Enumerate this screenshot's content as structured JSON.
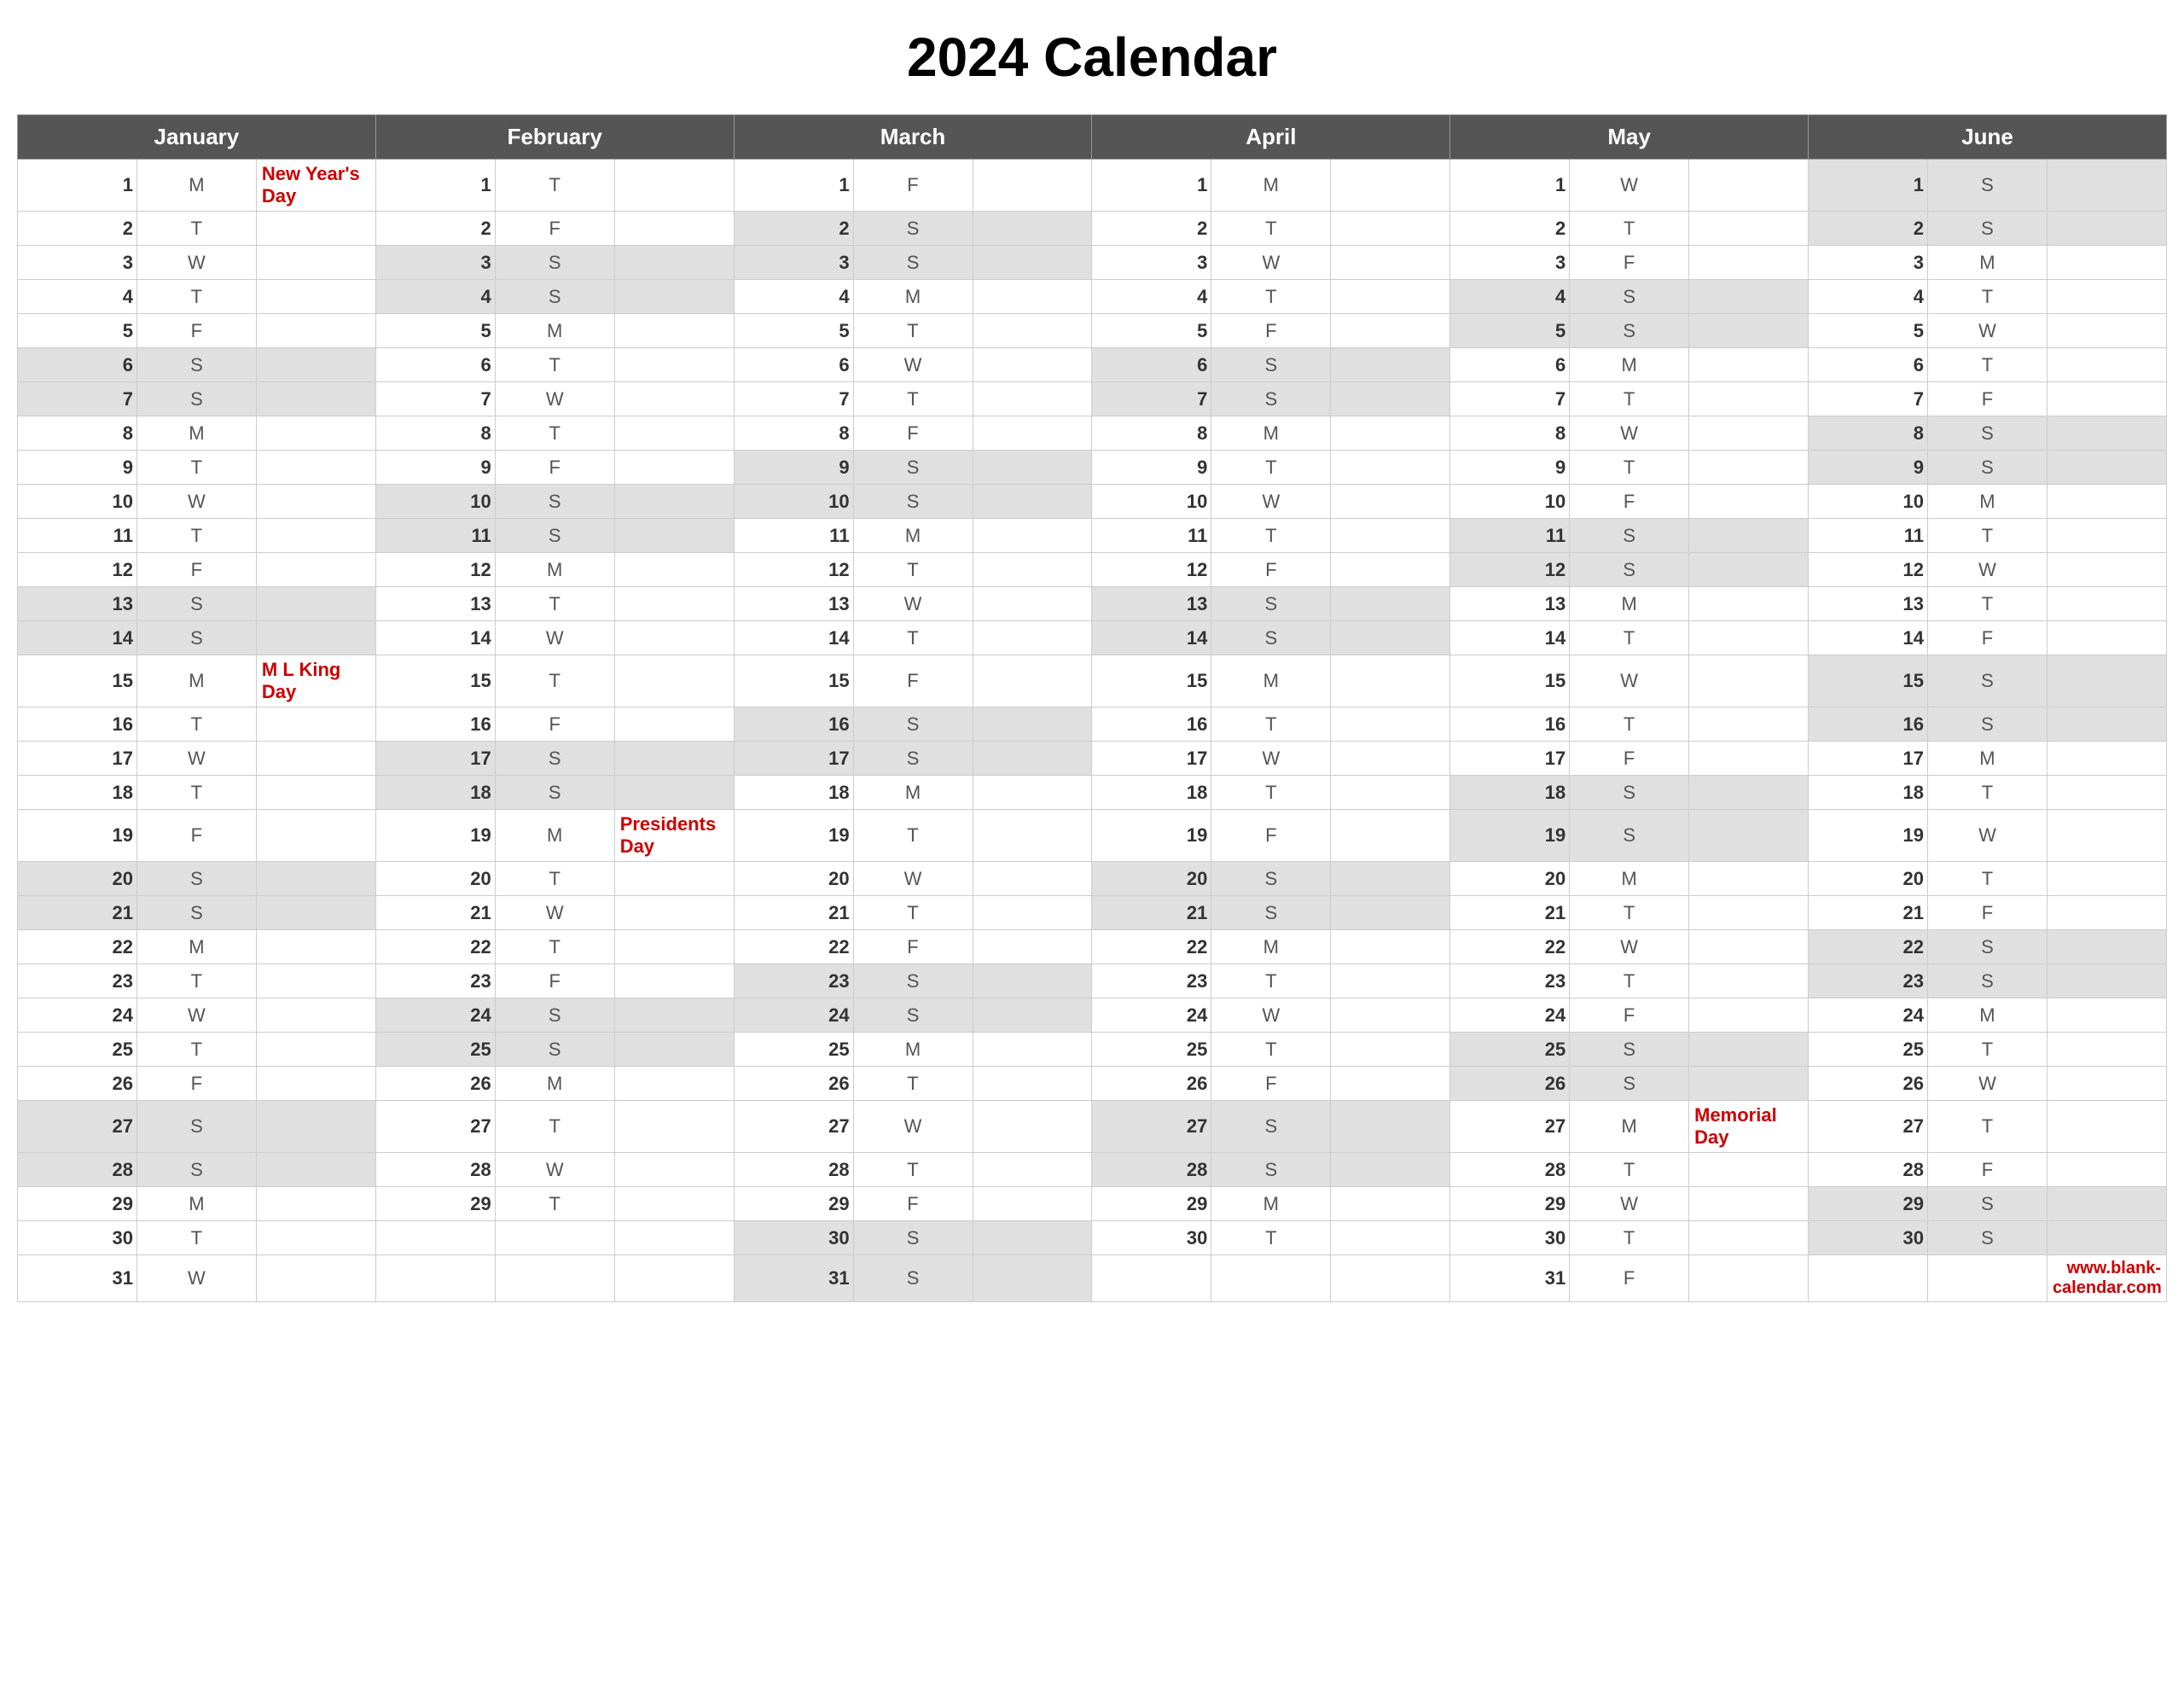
{
  "title": "2024 Calendar",
  "months": [
    "January",
    "February",
    "March",
    "April",
    "May",
    "June"
  ],
  "website": "www.blank-calendar.com",
  "calendar": {
    "january": [
      {
        "day": 1,
        "dow": "M",
        "holiday": "New Year's Day",
        "weekend": false
      },
      {
        "day": 2,
        "dow": "T",
        "holiday": "",
        "weekend": false
      },
      {
        "day": 3,
        "dow": "W",
        "holiday": "",
        "weekend": false
      },
      {
        "day": 4,
        "dow": "T",
        "holiday": "",
        "weekend": false
      },
      {
        "day": 5,
        "dow": "F",
        "holiday": "",
        "weekend": false
      },
      {
        "day": 6,
        "dow": "S",
        "holiday": "",
        "weekend": true
      },
      {
        "day": 7,
        "dow": "S",
        "holiday": "",
        "weekend": true
      },
      {
        "day": 8,
        "dow": "M",
        "holiday": "",
        "weekend": false
      },
      {
        "day": 9,
        "dow": "T",
        "holiday": "",
        "weekend": false
      },
      {
        "day": 10,
        "dow": "W",
        "holiday": "",
        "weekend": false
      },
      {
        "day": 11,
        "dow": "T",
        "holiday": "",
        "weekend": false
      },
      {
        "day": 12,
        "dow": "F",
        "holiday": "",
        "weekend": false
      },
      {
        "day": 13,
        "dow": "S",
        "holiday": "",
        "weekend": true
      },
      {
        "day": 14,
        "dow": "S",
        "holiday": "",
        "weekend": true
      },
      {
        "day": 15,
        "dow": "M",
        "holiday": "M L King Day",
        "weekend": false
      },
      {
        "day": 16,
        "dow": "T",
        "holiday": "",
        "weekend": false
      },
      {
        "day": 17,
        "dow": "W",
        "holiday": "",
        "weekend": false
      },
      {
        "day": 18,
        "dow": "T",
        "holiday": "",
        "weekend": false
      },
      {
        "day": 19,
        "dow": "F",
        "holiday": "",
        "weekend": false
      },
      {
        "day": 20,
        "dow": "S",
        "holiday": "",
        "weekend": true
      },
      {
        "day": 21,
        "dow": "S",
        "holiday": "",
        "weekend": true
      },
      {
        "day": 22,
        "dow": "M",
        "holiday": "",
        "weekend": false
      },
      {
        "day": 23,
        "dow": "T",
        "holiday": "",
        "weekend": false
      },
      {
        "day": 24,
        "dow": "W",
        "holiday": "",
        "weekend": false
      },
      {
        "day": 25,
        "dow": "T",
        "holiday": "",
        "weekend": false
      },
      {
        "day": 26,
        "dow": "F",
        "holiday": "",
        "weekend": false
      },
      {
        "day": 27,
        "dow": "S",
        "holiday": "",
        "weekend": true
      },
      {
        "day": 28,
        "dow": "S",
        "holiday": "",
        "weekend": true
      },
      {
        "day": 29,
        "dow": "M",
        "holiday": "",
        "weekend": false
      },
      {
        "day": 30,
        "dow": "T",
        "holiday": "",
        "weekend": false
      },
      {
        "day": 31,
        "dow": "W",
        "holiday": "",
        "weekend": false
      }
    ],
    "february": [
      {
        "day": 1,
        "dow": "T",
        "holiday": "",
        "weekend": false
      },
      {
        "day": 2,
        "dow": "F",
        "holiday": "",
        "weekend": false
      },
      {
        "day": 3,
        "dow": "S",
        "holiday": "",
        "weekend": true
      },
      {
        "day": 4,
        "dow": "S",
        "holiday": "",
        "weekend": true
      },
      {
        "day": 5,
        "dow": "M",
        "holiday": "",
        "weekend": false
      },
      {
        "day": 6,
        "dow": "T",
        "holiday": "",
        "weekend": false
      },
      {
        "day": 7,
        "dow": "W",
        "holiday": "",
        "weekend": false
      },
      {
        "day": 8,
        "dow": "T",
        "holiday": "",
        "weekend": false
      },
      {
        "day": 9,
        "dow": "F",
        "holiday": "",
        "weekend": false
      },
      {
        "day": 10,
        "dow": "S",
        "holiday": "",
        "weekend": true
      },
      {
        "day": 11,
        "dow": "S",
        "holiday": "",
        "weekend": true
      },
      {
        "day": 12,
        "dow": "M",
        "holiday": "",
        "weekend": false
      },
      {
        "day": 13,
        "dow": "T",
        "holiday": "",
        "weekend": false
      },
      {
        "day": 14,
        "dow": "W",
        "holiday": "",
        "weekend": false
      },
      {
        "day": 15,
        "dow": "T",
        "holiday": "",
        "weekend": false
      },
      {
        "day": 16,
        "dow": "F",
        "holiday": "",
        "weekend": false
      },
      {
        "day": 17,
        "dow": "S",
        "holiday": "",
        "weekend": true
      },
      {
        "day": 18,
        "dow": "S",
        "holiday": "",
        "weekend": true
      },
      {
        "day": 19,
        "dow": "M",
        "holiday": "Presidents Day",
        "weekend": false
      },
      {
        "day": 20,
        "dow": "T",
        "holiday": "",
        "weekend": false
      },
      {
        "day": 21,
        "dow": "W",
        "holiday": "",
        "weekend": false
      },
      {
        "day": 22,
        "dow": "T",
        "holiday": "",
        "weekend": false
      },
      {
        "day": 23,
        "dow": "F",
        "holiday": "",
        "weekend": false
      },
      {
        "day": 24,
        "dow": "S",
        "holiday": "",
        "weekend": true
      },
      {
        "day": 25,
        "dow": "S",
        "holiday": "",
        "weekend": true
      },
      {
        "day": 26,
        "dow": "M",
        "holiday": "",
        "weekend": false
      },
      {
        "day": 27,
        "dow": "T",
        "holiday": "",
        "weekend": false
      },
      {
        "day": 28,
        "dow": "W",
        "holiday": "",
        "weekend": false
      },
      {
        "day": 29,
        "dow": "T",
        "holiday": "",
        "weekend": false
      }
    ],
    "march": [
      {
        "day": 1,
        "dow": "F",
        "holiday": "",
        "weekend": false
      },
      {
        "day": 2,
        "dow": "S",
        "holiday": "",
        "weekend": true
      },
      {
        "day": 3,
        "dow": "S",
        "holiday": "",
        "weekend": true
      },
      {
        "day": 4,
        "dow": "M",
        "holiday": "",
        "weekend": false
      },
      {
        "day": 5,
        "dow": "T",
        "holiday": "",
        "weekend": false
      },
      {
        "day": 6,
        "dow": "W",
        "holiday": "",
        "weekend": false
      },
      {
        "day": 7,
        "dow": "T",
        "holiday": "",
        "weekend": false
      },
      {
        "day": 8,
        "dow": "F",
        "holiday": "",
        "weekend": false
      },
      {
        "day": 9,
        "dow": "S",
        "holiday": "",
        "weekend": true
      },
      {
        "day": 10,
        "dow": "S",
        "holiday": "",
        "weekend": true
      },
      {
        "day": 11,
        "dow": "M",
        "holiday": "",
        "weekend": false
      },
      {
        "day": 12,
        "dow": "T",
        "holiday": "",
        "weekend": false
      },
      {
        "day": 13,
        "dow": "W",
        "holiday": "",
        "weekend": false
      },
      {
        "day": 14,
        "dow": "T",
        "holiday": "",
        "weekend": false
      },
      {
        "day": 15,
        "dow": "F",
        "holiday": "",
        "weekend": false
      },
      {
        "day": 16,
        "dow": "S",
        "holiday": "",
        "weekend": true
      },
      {
        "day": 17,
        "dow": "S",
        "holiday": "",
        "weekend": true
      },
      {
        "day": 18,
        "dow": "M",
        "holiday": "",
        "weekend": false
      },
      {
        "day": 19,
        "dow": "T",
        "holiday": "",
        "weekend": false
      },
      {
        "day": 20,
        "dow": "W",
        "holiday": "",
        "weekend": false
      },
      {
        "day": 21,
        "dow": "T",
        "holiday": "",
        "weekend": false
      },
      {
        "day": 22,
        "dow": "F",
        "holiday": "",
        "weekend": false
      },
      {
        "day": 23,
        "dow": "S",
        "holiday": "",
        "weekend": true
      },
      {
        "day": 24,
        "dow": "S",
        "holiday": "",
        "weekend": true
      },
      {
        "day": 25,
        "dow": "M",
        "holiday": "",
        "weekend": false
      },
      {
        "day": 26,
        "dow": "T",
        "holiday": "",
        "weekend": false
      },
      {
        "day": 27,
        "dow": "W",
        "holiday": "",
        "weekend": false
      },
      {
        "day": 28,
        "dow": "T",
        "holiday": "",
        "weekend": false
      },
      {
        "day": 29,
        "dow": "F",
        "holiday": "",
        "weekend": false
      },
      {
        "day": 30,
        "dow": "S",
        "holiday": "",
        "weekend": true
      },
      {
        "day": 31,
        "dow": "S",
        "holiday": "",
        "weekend": true
      }
    ],
    "april": [
      {
        "day": 1,
        "dow": "M",
        "holiday": "",
        "weekend": false
      },
      {
        "day": 2,
        "dow": "T",
        "holiday": "",
        "weekend": false
      },
      {
        "day": 3,
        "dow": "W",
        "holiday": "",
        "weekend": false
      },
      {
        "day": 4,
        "dow": "T",
        "holiday": "",
        "weekend": false
      },
      {
        "day": 5,
        "dow": "F",
        "holiday": "",
        "weekend": false
      },
      {
        "day": 6,
        "dow": "S",
        "holiday": "",
        "weekend": true
      },
      {
        "day": 7,
        "dow": "S",
        "holiday": "",
        "weekend": true
      },
      {
        "day": 8,
        "dow": "M",
        "holiday": "",
        "weekend": false
      },
      {
        "day": 9,
        "dow": "T",
        "holiday": "",
        "weekend": false
      },
      {
        "day": 10,
        "dow": "W",
        "holiday": "",
        "weekend": false
      },
      {
        "day": 11,
        "dow": "T",
        "holiday": "",
        "weekend": false
      },
      {
        "day": 12,
        "dow": "F",
        "holiday": "",
        "weekend": false
      },
      {
        "day": 13,
        "dow": "S",
        "holiday": "",
        "weekend": true
      },
      {
        "day": 14,
        "dow": "S",
        "holiday": "",
        "weekend": true
      },
      {
        "day": 15,
        "dow": "M",
        "holiday": "",
        "weekend": false
      },
      {
        "day": 16,
        "dow": "T",
        "holiday": "",
        "weekend": false
      },
      {
        "day": 17,
        "dow": "W",
        "holiday": "",
        "weekend": false
      },
      {
        "day": 18,
        "dow": "T",
        "holiday": "",
        "weekend": false
      },
      {
        "day": 19,
        "dow": "F",
        "holiday": "",
        "weekend": false
      },
      {
        "day": 20,
        "dow": "S",
        "holiday": "",
        "weekend": true
      },
      {
        "day": 21,
        "dow": "S",
        "holiday": "",
        "weekend": true
      },
      {
        "day": 22,
        "dow": "M",
        "holiday": "",
        "weekend": false
      },
      {
        "day": 23,
        "dow": "T",
        "holiday": "",
        "weekend": false
      },
      {
        "day": 24,
        "dow": "W",
        "holiday": "",
        "weekend": false
      },
      {
        "day": 25,
        "dow": "T",
        "holiday": "",
        "weekend": false
      },
      {
        "day": 26,
        "dow": "F",
        "holiday": "",
        "weekend": false
      },
      {
        "day": 27,
        "dow": "S",
        "holiday": "",
        "weekend": true
      },
      {
        "day": 28,
        "dow": "S",
        "holiday": "",
        "weekend": true
      },
      {
        "day": 29,
        "dow": "M",
        "holiday": "",
        "weekend": false
      },
      {
        "day": 30,
        "dow": "T",
        "holiday": "",
        "weekend": false
      }
    ],
    "may": [
      {
        "day": 1,
        "dow": "W",
        "holiday": "",
        "weekend": false
      },
      {
        "day": 2,
        "dow": "T",
        "holiday": "",
        "weekend": false
      },
      {
        "day": 3,
        "dow": "F",
        "holiday": "",
        "weekend": false
      },
      {
        "day": 4,
        "dow": "S",
        "holiday": "",
        "weekend": true
      },
      {
        "day": 5,
        "dow": "S",
        "holiday": "",
        "weekend": true
      },
      {
        "day": 6,
        "dow": "M",
        "holiday": "",
        "weekend": false
      },
      {
        "day": 7,
        "dow": "T",
        "holiday": "",
        "weekend": false
      },
      {
        "day": 8,
        "dow": "W",
        "holiday": "",
        "weekend": false
      },
      {
        "day": 9,
        "dow": "T",
        "holiday": "",
        "weekend": false
      },
      {
        "day": 10,
        "dow": "F",
        "holiday": "",
        "weekend": false
      },
      {
        "day": 11,
        "dow": "S",
        "holiday": "",
        "weekend": true
      },
      {
        "day": 12,
        "dow": "S",
        "holiday": "",
        "weekend": true
      },
      {
        "day": 13,
        "dow": "M",
        "holiday": "",
        "weekend": false
      },
      {
        "day": 14,
        "dow": "T",
        "holiday": "",
        "weekend": false
      },
      {
        "day": 15,
        "dow": "W",
        "holiday": "",
        "weekend": false
      },
      {
        "day": 16,
        "dow": "T",
        "holiday": "",
        "weekend": false
      },
      {
        "day": 17,
        "dow": "F",
        "holiday": "",
        "weekend": false
      },
      {
        "day": 18,
        "dow": "S",
        "holiday": "",
        "weekend": true
      },
      {
        "day": 19,
        "dow": "S",
        "holiday": "",
        "weekend": true
      },
      {
        "day": 20,
        "dow": "M",
        "holiday": "",
        "weekend": false
      },
      {
        "day": 21,
        "dow": "T",
        "holiday": "",
        "weekend": false
      },
      {
        "day": 22,
        "dow": "W",
        "holiday": "",
        "weekend": false
      },
      {
        "day": 23,
        "dow": "T",
        "holiday": "",
        "weekend": false
      },
      {
        "day": 24,
        "dow": "F",
        "holiday": "",
        "weekend": false
      },
      {
        "day": 25,
        "dow": "S",
        "holiday": "",
        "weekend": true
      },
      {
        "day": 26,
        "dow": "S",
        "holiday": "",
        "weekend": true
      },
      {
        "day": 27,
        "dow": "M",
        "holiday": "Memorial Day",
        "weekend": false
      },
      {
        "day": 28,
        "dow": "T",
        "holiday": "",
        "weekend": false
      },
      {
        "day": 29,
        "dow": "W",
        "holiday": "",
        "weekend": false
      },
      {
        "day": 30,
        "dow": "T",
        "holiday": "",
        "weekend": false
      },
      {
        "day": 31,
        "dow": "F",
        "holiday": "",
        "weekend": false
      }
    ],
    "june": [
      {
        "day": 1,
        "dow": "S",
        "holiday": "",
        "weekend": true
      },
      {
        "day": 2,
        "dow": "S",
        "holiday": "",
        "weekend": true
      },
      {
        "day": 3,
        "dow": "M",
        "holiday": "",
        "weekend": false
      },
      {
        "day": 4,
        "dow": "T",
        "holiday": "",
        "weekend": false
      },
      {
        "day": 5,
        "dow": "W",
        "holiday": "",
        "weekend": false
      },
      {
        "day": 6,
        "dow": "T",
        "holiday": "",
        "weekend": false
      },
      {
        "day": 7,
        "dow": "F",
        "holiday": "",
        "weekend": false
      },
      {
        "day": 8,
        "dow": "S",
        "holiday": "",
        "weekend": true
      },
      {
        "day": 9,
        "dow": "S",
        "holiday": "",
        "weekend": true
      },
      {
        "day": 10,
        "dow": "M",
        "holiday": "",
        "weekend": false
      },
      {
        "day": 11,
        "dow": "T",
        "holiday": "",
        "weekend": false
      },
      {
        "day": 12,
        "dow": "W",
        "holiday": "",
        "weekend": false
      },
      {
        "day": 13,
        "dow": "T",
        "holiday": "",
        "weekend": false
      },
      {
        "day": 14,
        "dow": "F",
        "holiday": "",
        "weekend": false
      },
      {
        "day": 15,
        "dow": "S",
        "holiday": "",
        "weekend": true
      },
      {
        "day": 16,
        "dow": "S",
        "holiday": "",
        "weekend": true
      },
      {
        "day": 17,
        "dow": "M",
        "holiday": "",
        "weekend": false
      },
      {
        "day": 18,
        "dow": "T",
        "holiday": "",
        "weekend": false
      },
      {
        "day": 19,
        "dow": "W",
        "holiday": "",
        "weekend": false
      },
      {
        "day": 20,
        "dow": "T",
        "holiday": "",
        "weekend": false
      },
      {
        "day": 21,
        "dow": "F",
        "holiday": "",
        "weekend": false
      },
      {
        "day": 22,
        "dow": "S",
        "holiday": "",
        "weekend": true
      },
      {
        "day": 23,
        "dow": "S",
        "holiday": "",
        "weekend": true
      },
      {
        "day": 24,
        "dow": "M",
        "holiday": "",
        "weekend": false
      },
      {
        "day": 25,
        "dow": "T",
        "holiday": "",
        "weekend": false
      },
      {
        "day": 26,
        "dow": "W",
        "holiday": "",
        "weekend": false
      },
      {
        "day": 27,
        "dow": "T",
        "holiday": "",
        "weekend": false
      },
      {
        "day": 28,
        "dow": "F",
        "holiday": "",
        "weekend": false
      },
      {
        "day": 29,
        "dow": "S",
        "holiday": "",
        "weekend": true
      },
      {
        "day": 30,
        "dow": "S",
        "holiday": "",
        "weekend": true
      }
    ]
  }
}
